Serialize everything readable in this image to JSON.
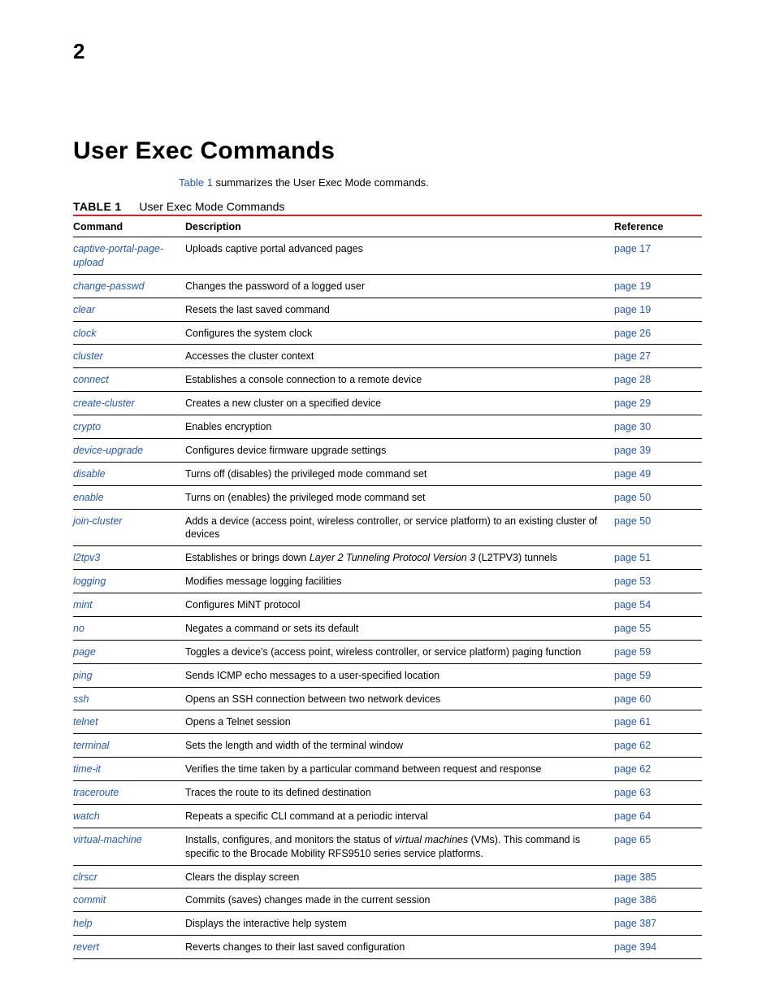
{
  "chapter_number": "2",
  "heading": "User Exec Commands",
  "intro_prefix": "Table 1",
  "intro_rest": " summarizes the User Exec Mode commands.",
  "table_label": "TABLE 1",
  "table_caption": "User Exec Mode Commands",
  "columns": {
    "command": "Command",
    "description": "Description",
    "reference": "Reference"
  },
  "rows": [
    {
      "cmd": "captive-portal-page-upload",
      "desc": "Uploads captive portal advanced pages",
      "ref": "page 17"
    },
    {
      "cmd": "change-passwd",
      "desc": "Changes the password of a logged user",
      "ref": "page 19"
    },
    {
      "cmd": "clear",
      "desc": "Resets the last saved command",
      "ref": "page 19"
    },
    {
      "cmd": "clock",
      "desc": "Configures the system clock",
      "ref": "page 26"
    },
    {
      "cmd": "cluster",
      "desc": "Accesses the cluster context",
      "ref": "page 27"
    },
    {
      "cmd": "connect",
      "desc": "Establishes a console connection to a remote device",
      "ref": "page 28"
    },
    {
      "cmd": "create-cluster",
      "desc": "Creates a new cluster on a specified device",
      "ref": "page 29"
    },
    {
      "cmd": "crypto",
      "desc": "Enables encryption",
      "ref": "page 30"
    },
    {
      "cmd": "device-upgrade",
      "desc": "Configures device firmware upgrade settings",
      "ref": "page 39"
    },
    {
      "cmd": "disable",
      "desc": "Turns off (disables) the privileged mode command set",
      "ref": "page 49"
    },
    {
      "cmd": "enable",
      "desc": "Turns on (enables) the privileged mode command set",
      "ref": "page 50"
    },
    {
      "cmd": "join-cluster",
      "desc": "Adds a device (access point, wireless controller, or service platform) to an existing cluster of devices",
      "ref": "page 50"
    },
    {
      "cmd": "l2tpv3",
      "desc_parts": [
        "Establishes or brings down ",
        "Layer 2 Tunneling Protocol Version 3",
        " (L2TPV3) tunnels"
      ],
      "ref": "page 51"
    },
    {
      "cmd": "logging",
      "desc": "Modifies message logging facilities",
      "ref": "page 53"
    },
    {
      "cmd": "mint",
      "desc": "Configures MiNT protocol",
      "ref": "page 54"
    },
    {
      "cmd": "no",
      "desc": "Negates a command or sets its default",
      "ref": "page 55"
    },
    {
      "cmd": "page",
      "desc": "Toggles a device's (access point, wireless controller, or service platform) paging function",
      "ref": "page 59"
    },
    {
      "cmd": "ping",
      "desc": "Sends ICMP echo messages to a user-specified location",
      "ref": "page 59"
    },
    {
      "cmd": "ssh",
      "desc": "Opens an SSH connection between two network devices",
      "ref": "page 60"
    },
    {
      "cmd": "telnet",
      "desc": "Opens a Telnet session",
      "ref": "page 61"
    },
    {
      "cmd": "terminal",
      "desc": "Sets the length and width of the terminal window",
      "ref": "page 62"
    },
    {
      "cmd": "time-it",
      "desc": "Verifies the time taken by a particular command between request and response",
      "ref": "page 62"
    },
    {
      "cmd": "traceroute",
      "desc": "Traces the route to its defined destination",
      "ref": "page 63"
    },
    {
      "cmd": "watch",
      "desc": "Repeats a specific CLI command at a periodic interval",
      "ref": "page 64"
    },
    {
      "cmd": "virtual-machine",
      "desc_parts": [
        "Installs, configures, and monitors the status of ",
        "virtual machines",
        " (VMs). This command is specific to the Brocade Mobility RFS9510 series service platforms."
      ],
      "ref": "page 65"
    },
    {
      "cmd": "clrscr",
      "desc": "Clears the display screen",
      "ref": "page 385"
    },
    {
      "cmd": "commit",
      "desc": "Commits (saves) changes made in the current session",
      "ref": "page 386"
    },
    {
      "cmd": "help",
      "desc": "Displays the interactive help system",
      "ref": "page 387"
    },
    {
      "cmd": "revert",
      "desc": "Reverts changes to their last saved configuration",
      "ref": "page 394"
    }
  ]
}
